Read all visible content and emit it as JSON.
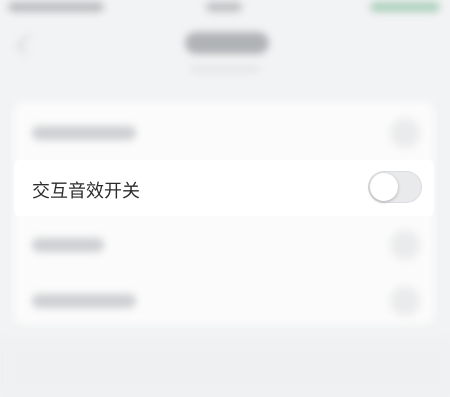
{
  "settings": {
    "rows": [
      {
        "label": "交互音效开关",
        "toggle_on": false
      }
    ]
  },
  "colors": {
    "background": "#f2f3f4",
    "card": "#ffffff",
    "toggle_off": "#e9eaec",
    "status_accent": "#7fb99a"
  }
}
